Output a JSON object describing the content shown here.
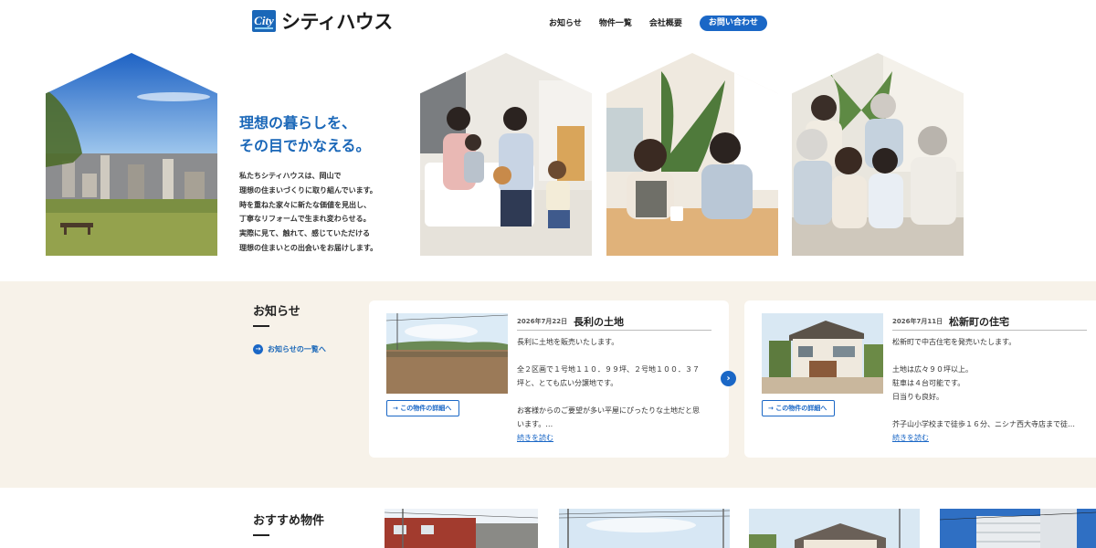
{
  "header": {
    "logo_mark": "City",
    "logo_text": "シティハウス",
    "nav": [
      "お知らせ",
      "物件一覧",
      "会社概要"
    ],
    "contact": "お問い合わせ"
  },
  "hero": {
    "title_lines": [
      "理想の暮らしを、",
      "その目でかなえる。"
    ],
    "description_lines": [
      "私たちシティハウスは、岡山で",
      "理想の住まいづくりに取り組んでいます。",
      "時を重ねた家々に新たな価値を見出し、",
      "丁寧なリフォームで生まれ変わらせる。",
      "実際に見て、触れて、感じていただける",
      "理想の住まいとの出会いをお届けします。"
    ]
  },
  "news": {
    "title": "お知らせ",
    "list_link": "お知らせの一覧へ",
    "cards": [
      {
        "date": "2026年7月22日",
        "title": "長利の土地",
        "body": [
          "長利に土地を販売いたします。",
          "",
          "全２区画で１号地１１０．９９坪、２号地１００．３７",
          "坪と、とても広い分譲地です。",
          "",
          "お客様からのご要望が多い平屋にぴったりな土地だと思",
          "います。…"
        ],
        "detail_button": "→ この物件の詳細へ",
        "read_more": "続きを読む"
      },
      {
        "date": "2026年7月11日",
        "title": "松新町の住宅",
        "body": [
          "松新町で中古住宅を発売いたします。",
          "",
          "土地は広々９０坪以上。",
          "駐車は４台可能です。",
          "日当りも良好。",
          "",
          "芥子山小学校まで徒歩１６分、ニシナ西大寺店まで徒…"
        ],
        "detail_button": "→ この物件の詳細へ",
        "read_more": "続きを読む"
      }
    ],
    "next_icon": "chevron-right-icon"
  },
  "recommended": {
    "title": "おすすめ物件"
  }
}
